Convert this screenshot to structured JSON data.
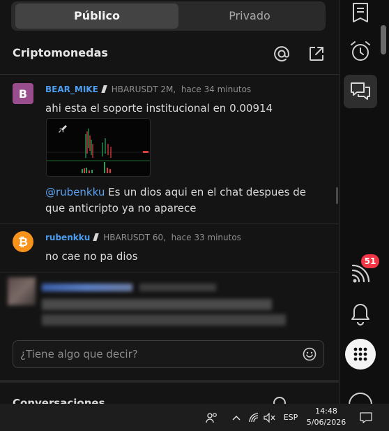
{
  "tabs": {
    "public": "Público",
    "private": "Privado"
  },
  "room": {
    "title": "Criptomonedas"
  },
  "messages": [
    {
      "avatar_letter": "B",
      "avatar_color": "#9a4d8c",
      "user": "BEAR_MIKE",
      "symbol_info": "HBARUSDT 2M,",
      "time": "hace 34 minutos",
      "text": "ahi esta el soporte institucional en 0.00914",
      "reply_mention": "@rubenkku",
      "reply_text_1": " Es un dios aqui en el chat despues de",
      "reply_text_2": "que anticripto ya no aparece"
    },
    {
      "avatar_icon": "bitcoin-icon",
      "avatar_color": "#f7931a",
      "user": "rubenkku",
      "symbol_info": "HBARUSDT 60,",
      "time": "hace 33 minutos",
      "text": "no cae no pa dios"
    }
  ],
  "composer": {
    "placeholder": "¿Tiene algo que decir?"
  },
  "conversations": {
    "title": "Conversaciones"
  },
  "toolbar": {
    "items": [
      "notes-icon",
      "alarm-clock-icon",
      "chat-icon",
      "signal-feed-icon",
      "bell-icon",
      "apps-grid-icon"
    ],
    "notifications_badge": "51"
  },
  "taskbar": {
    "lang": "ESP",
    "time": "14:48",
    "date": "5/06/2026"
  },
  "colors": {
    "accent": "#4c9cf0",
    "badge": "#f23645",
    "background": "#141414"
  }
}
